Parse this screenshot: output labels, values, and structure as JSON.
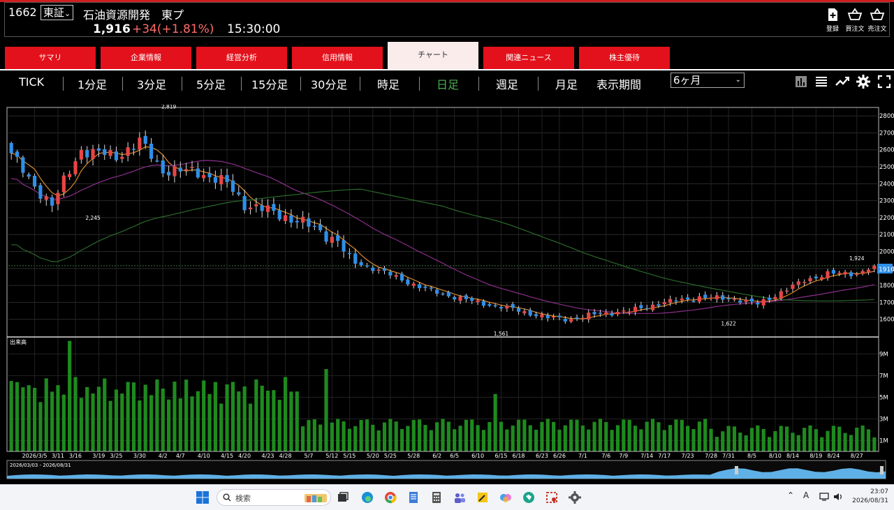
{
  "header": {
    "code": "1662",
    "market": "東証",
    "market_arrow": "⌄",
    "name": "石油資源開発　東プ",
    "price": "1,916",
    "change": "+34(+1.81%)",
    "time": "15:30:00",
    "buttons": [
      {
        "label": "登録",
        "icon": "plus-doc-icon"
      },
      {
        "label": "買注文",
        "icon": "basket-icon"
      },
      {
        "label": "売注文",
        "icon": "basket-icon"
      }
    ]
  },
  "tabs": [
    {
      "label": "サマリ",
      "active": false
    },
    {
      "label": "企業情報",
      "active": false
    },
    {
      "label": "経営分析",
      "active": false
    },
    {
      "label": "信用情報",
      "active": false
    },
    {
      "label": "チャート",
      "active": true
    },
    {
      "label": "関連ニュース",
      "active": false
    },
    {
      "label": "株主優待",
      "active": false
    }
  ],
  "periods": [
    "TICK",
    "1分足",
    "3分足",
    "5分足",
    "15分足",
    "30分足",
    "時足",
    "日足",
    "週足",
    "月足"
  ],
  "active_period": "日足",
  "display_period_label": "表示期間",
  "display_period_value": "6ヶ月",
  "tools": [
    "bar-chart-icon",
    "list-icon",
    "trend-icon",
    "gear-icon",
    "fullscreen-icon"
  ],
  "colors": {
    "up": "#e84545",
    "down": "#2f8fe8",
    "ma_short": "#d98a2b",
    "ma_mid": "#8a2f8a",
    "ma_long": "#2a6a2a",
    "volume": "#1e8a1e",
    "tab": "#e3111b"
  },
  "chart_data": {
    "type": "candlestick",
    "price_axis": {
      "ticks": [
        1600,
        1700,
        1800,
        1900,
        2000,
        2100,
        2200,
        2300,
        2400,
        2500,
        2600,
        2700,
        2800
      ],
      "range": [
        1500,
        2850
      ]
    },
    "volume_panel_label": "出来高",
    "volume_axis": {
      "ticks": [
        "1M",
        "3M",
        "5M",
        "7M",
        "9M"
      ]
    },
    "x_labels": [
      "2026/3/5",
      "3/11",
      "3/16",
      "3/19",
      "3/25",
      "3/30",
      "4/2",
      "4/7",
      "4/10",
      "4/15",
      "4/20",
      "4/23",
      "4/28",
      "5/7",
      "5/12",
      "5/15",
      "5/20",
      "5/25",
      "5/28",
      "6/2",
      "6/5",
      "6/10",
      "6/15",
      "6/18",
      "6/23",
      "6/26",
      "7/1",
      "7/6",
      "7/9",
      "7/14",
      "7/17",
      "7/23",
      "7/28",
      "7/31",
      "8/5",
      "8/10",
      "8/14",
      "8/19",
      "8/24",
      "8/27"
    ],
    "annotations": [
      {
        "label": "2,819"
      },
      {
        "label": "2,245"
      },
      {
        "label": "1,561"
      },
      {
        "label": "1,622"
      },
      {
        "label": "1,924"
      }
    ],
    "last_price_label": "1916",
    "range_label": "2026/03/03 - 2026/08/31",
    "close_keypoints": [
      [
        0,
        2580
      ],
      [
        3,
        2420
      ],
      [
        7,
        2280
      ],
      [
        12,
        2600
      ],
      [
        18,
        2560
      ],
      [
        22,
        2650
      ],
      [
        26,
        2480
      ],
      [
        32,
        2470
      ],
      [
        37,
        2400
      ],
      [
        40,
        2280
      ],
      [
        46,
        2220
      ],
      [
        52,
        2140
      ],
      [
        56,
        2060
      ],
      [
        58,
        1950
      ],
      [
        62,
        1900
      ],
      [
        66,
        1850
      ],
      [
        70,
        1790
      ],
      [
        75,
        1740
      ],
      [
        80,
        1700
      ],
      [
        86,
        1660
      ],
      [
        92,
        1610
      ],
      [
        96,
        1600
      ],
      [
        100,
        1630
      ],
      [
        106,
        1650
      ],
      [
        112,
        1700
      ],
      [
        118,
        1730
      ],
      [
        124,
        1720
      ],
      [
        128,
        1690
      ],
      [
        132,
        1760
      ],
      [
        136,
        1830
      ],
      [
        140,
        1870
      ],
      [
        145,
        1870
      ],
      [
        148,
        1916
      ]
    ]
  },
  "taskbar": {
    "search_placeholder": "検索",
    "ime": "A",
    "time": "23:07",
    "date": "2026/08/31"
  }
}
